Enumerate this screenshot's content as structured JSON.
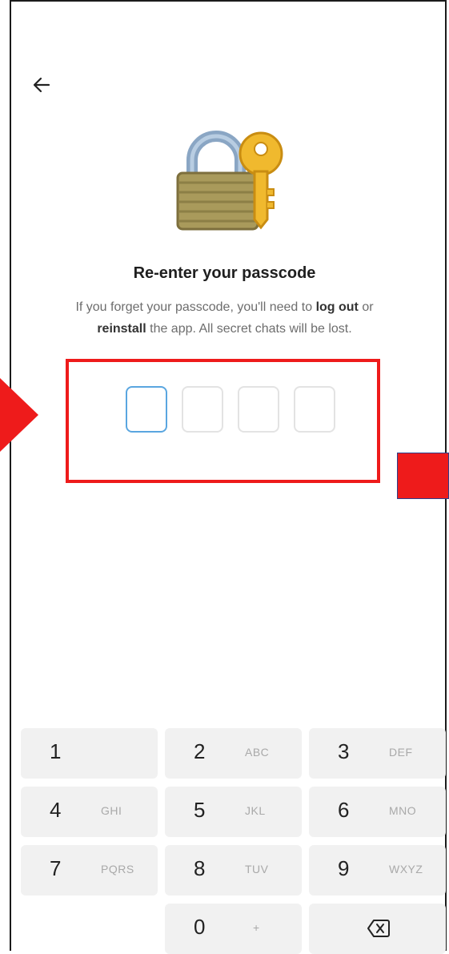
{
  "screen": {
    "title": "Re-enter your passcode",
    "description_part1": "If you forget your passcode, you'll need to ",
    "description_bold1": "log out",
    "description_part2": " or ",
    "description_bold2": "reinstall",
    "description_part3": " the app. All secret chats will be lost."
  },
  "icons": {
    "back": "arrow-left-icon",
    "lock": "padlock-with-key-icon",
    "backspace": "backspace-icon"
  },
  "passcode": {
    "length": 4,
    "filled": 0,
    "active_index": 0
  },
  "keypad": {
    "keys": [
      {
        "digit": "1",
        "letters": ""
      },
      {
        "digit": "2",
        "letters": "ABC"
      },
      {
        "digit": "3",
        "letters": "DEF"
      },
      {
        "digit": "4",
        "letters": "GHI"
      },
      {
        "digit": "5",
        "letters": "JKL"
      },
      {
        "digit": "6",
        "letters": "MNO"
      },
      {
        "digit": "7",
        "letters": "PQRS"
      },
      {
        "digit": "8",
        "letters": "TUV"
      },
      {
        "digit": "9",
        "letters": "WXYZ"
      },
      {
        "digit": "0",
        "letters": "+"
      }
    ]
  },
  "colors": {
    "annotation_red": "#ee1b1b",
    "active_box_border": "#5aa6e0",
    "key_background": "#f1f1f1"
  }
}
